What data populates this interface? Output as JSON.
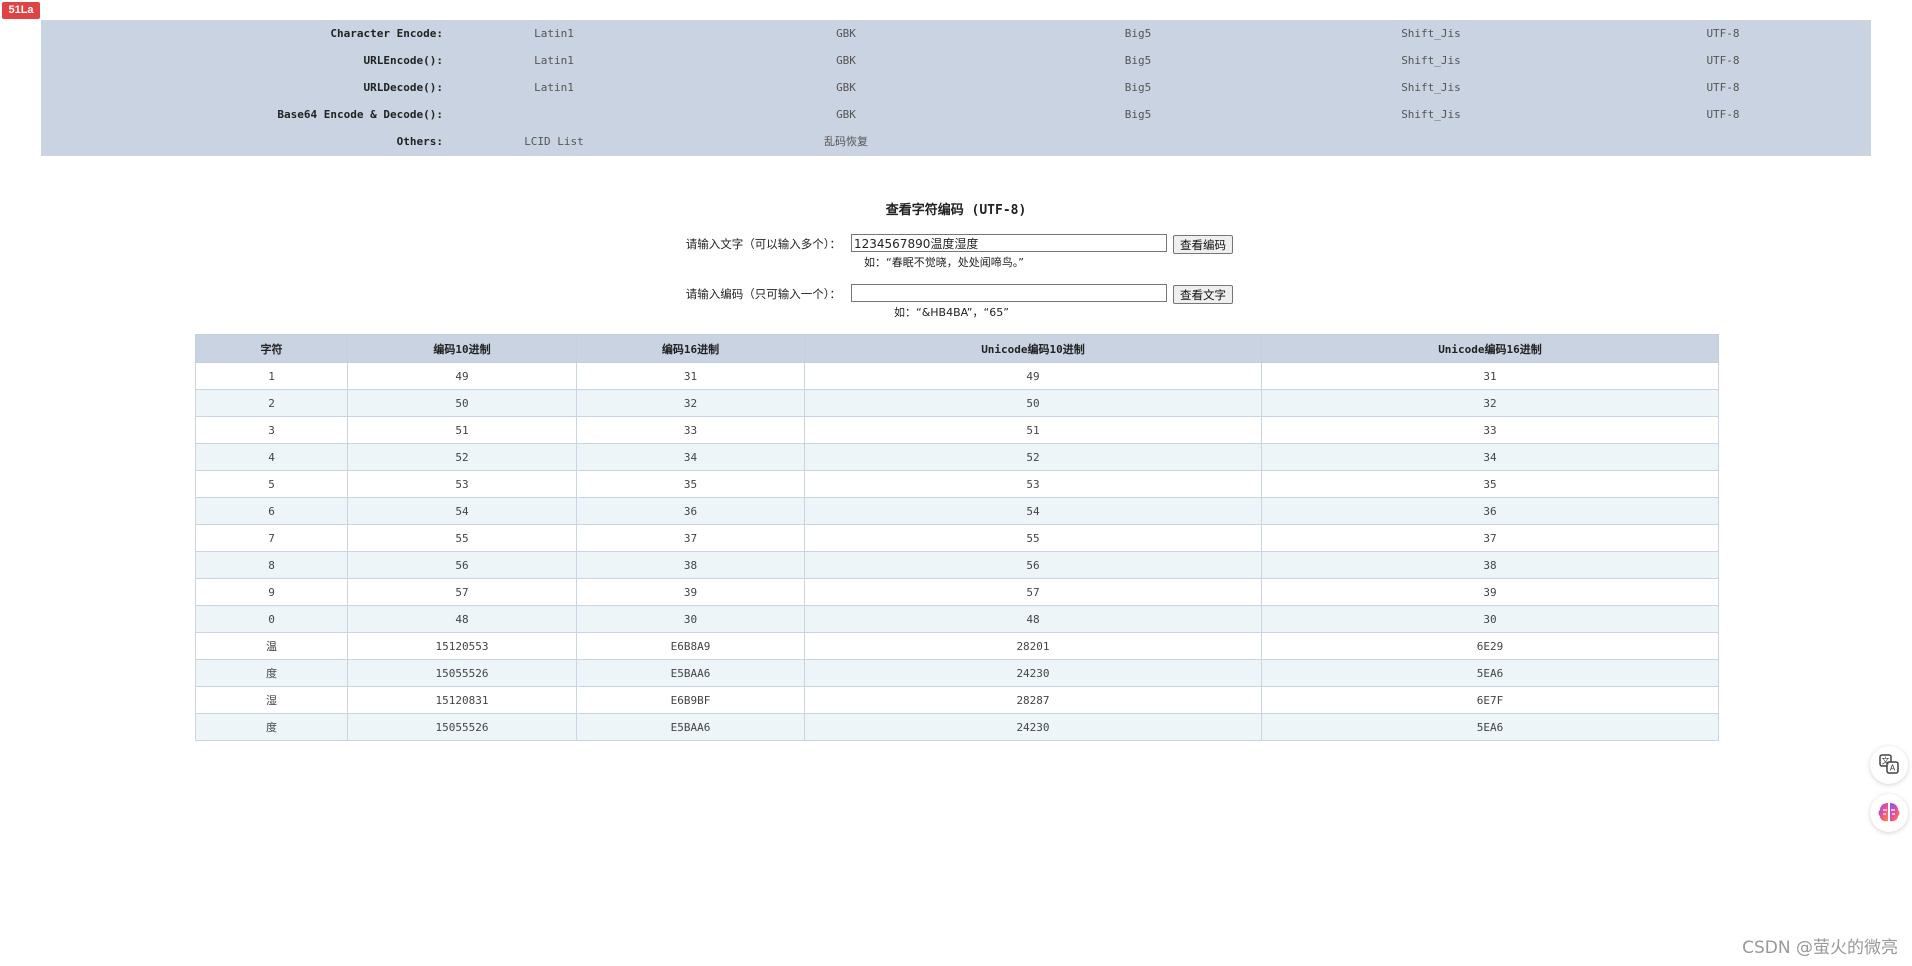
{
  "badge": "51La",
  "nav": {
    "rows": [
      {
        "label": "Character Encode:",
        "items": [
          "Latin1",
          "GBK",
          "Big5",
          "Shift_Jis",
          "UTF-8"
        ]
      },
      {
        "label": "URLEncode():",
        "items": [
          "Latin1",
          "GBK",
          "Big5",
          "Shift_Jis",
          "UTF-8"
        ]
      },
      {
        "label": "URLDecode():",
        "items": [
          "Latin1",
          "GBK",
          "Big5",
          "Shift_Jis",
          "UTF-8"
        ]
      },
      {
        "label": "Base64 Encode & Decode():",
        "items": [
          "",
          "GBK",
          "Big5",
          "Shift_Jis",
          "UTF-8"
        ]
      },
      {
        "label": "Others:",
        "items": [
          "LCID List",
          "乱码恢复",
          "",
          "",
          ""
        ]
      }
    ]
  },
  "title": "查看字符编码 (UTF-8)",
  "form": {
    "text_label": "请输入文字（可以输入多个）：",
    "text_value": "1234567890温度湿度",
    "text_button": "查看编码",
    "text_hint": "如：“春眠不觉晓，处处闻啼鸟。”",
    "code_label": "请输入编码（只可输入一个）：",
    "code_value": "",
    "code_button": "查看文字",
    "code_hint": "如：“&HB4BA”，“65”"
  },
  "table": {
    "headers": [
      "字符",
      "编码10进制",
      "编码16进制",
      "Unicode编码10进制",
      "Unicode编码16进制"
    ],
    "rows": [
      [
        "1",
        "49",
        "31",
        "49",
        "31"
      ],
      [
        "2",
        "50",
        "32",
        "50",
        "32"
      ],
      [
        "3",
        "51",
        "33",
        "51",
        "33"
      ],
      [
        "4",
        "52",
        "34",
        "52",
        "34"
      ],
      [
        "5",
        "53",
        "35",
        "53",
        "35"
      ],
      [
        "6",
        "54",
        "36",
        "54",
        "36"
      ],
      [
        "7",
        "55",
        "37",
        "55",
        "37"
      ],
      [
        "8",
        "56",
        "38",
        "56",
        "38"
      ],
      [
        "9",
        "57",
        "39",
        "57",
        "39"
      ],
      [
        "0",
        "48",
        "30",
        "48",
        "30"
      ],
      [
        "温",
        "15120553",
        "E6B8A9",
        "28201",
        "6E29"
      ],
      [
        "度",
        "15055526",
        "E5BAA6",
        "24230",
        "5EA6"
      ],
      [
        "湿",
        "15120831",
        "E6B9BF",
        "28287",
        "6E7F"
      ],
      [
        "度",
        "15055526",
        "E5BAA6",
        "24230",
        "5EA6"
      ]
    ]
  },
  "side_buttons": [
    "translate-icon",
    "ai-brain-icon"
  ],
  "watermark": "CSDN @萤火的微亮"
}
